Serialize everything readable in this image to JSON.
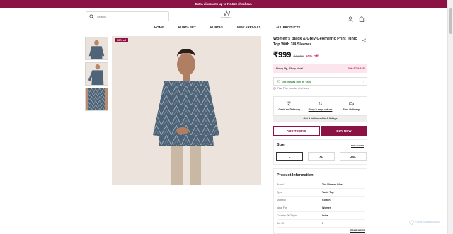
{
  "announcement": "Extra discounts up to Rs.650 checkout.",
  "search": {
    "placeholder": "Search"
  },
  "logo": {
    "text": "WOMEN'S"
  },
  "header_icons": [
    "user-icon",
    "bag-icon"
  ],
  "nav": [
    {
      "label": "HOME"
    },
    {
      "label": "KURTA SET"
    },
    {
      "label": "KURTAS"
    },
    {
      "label": "NEW ARRIVALS"
    },
    {
      "label": "ALL PRODUCTS"
    }
  ],
  "gallery": {
    "badge": "50% off",
    "thumbnail_count": 3
  },
  "product": {
    "title": "Women's Black & Grey Geometric Print Tunic Top With 3/4 Sleeves",
    "price": "₹999",
    "mrp": "₹1,999",
    "discount": "50% Off"
  },
  "urgency": {
    "label": "Hurry Up, Shop Now!",
    "timer": "00H:57M:43S"
  },
  "offer": {
    "label": "Get this as low as ₹850",
    "chevron": "›"
  },
  "inclusive_note": "Final Price inclusive of all taxes",
  "services": [
    {
      "icon": "rupee-icon",
      "label": "Cash on Delivery"
    },
    {
      "icon": "return-icon",
      "label": "Easy 5 days return"
    },
    {
      "icon": "truck-icon",
      "label": "Free Delivery"
    }
  ],
  "delivery_note": "Get it delivered in 4-9 days",
  "buttons": {
    "add_to_bag": "ADD TO BAG",
    "buy_now": "BUY NOW"
  },
  "size": {
    "heading": "Size",
    "chart_link": "SIZE CHART",
    "options": [
      "L",
      "XL",
      "2XL"
    ],
    "selected": "L"
  },
  "info": {
    "heading": "Product Information",
    "rows": [
      {
        "key": "Brand",
        "value": "The Women Plus"
      },
      {
        "key": "Type",
        "value": "Tunic Top"
      },
      {
        "key": "Material",
        "value": "Cotton"
      },
      {
        "key": "Ideal For",
        "value": "Women"
      },
      {
        "key": "Country Of Origin",
        "value": "India"
      },
      {
        "key": "Set Of",
        "value": "1"
      }
    ],
    "read_more": "READ MORE"
  },
  "watermark": "ScanMalware",
  "colors": {
    "brand": "#8a1244",
    "discount": "#c2185b",
    "offer": "#2e7d32"
  }
}
